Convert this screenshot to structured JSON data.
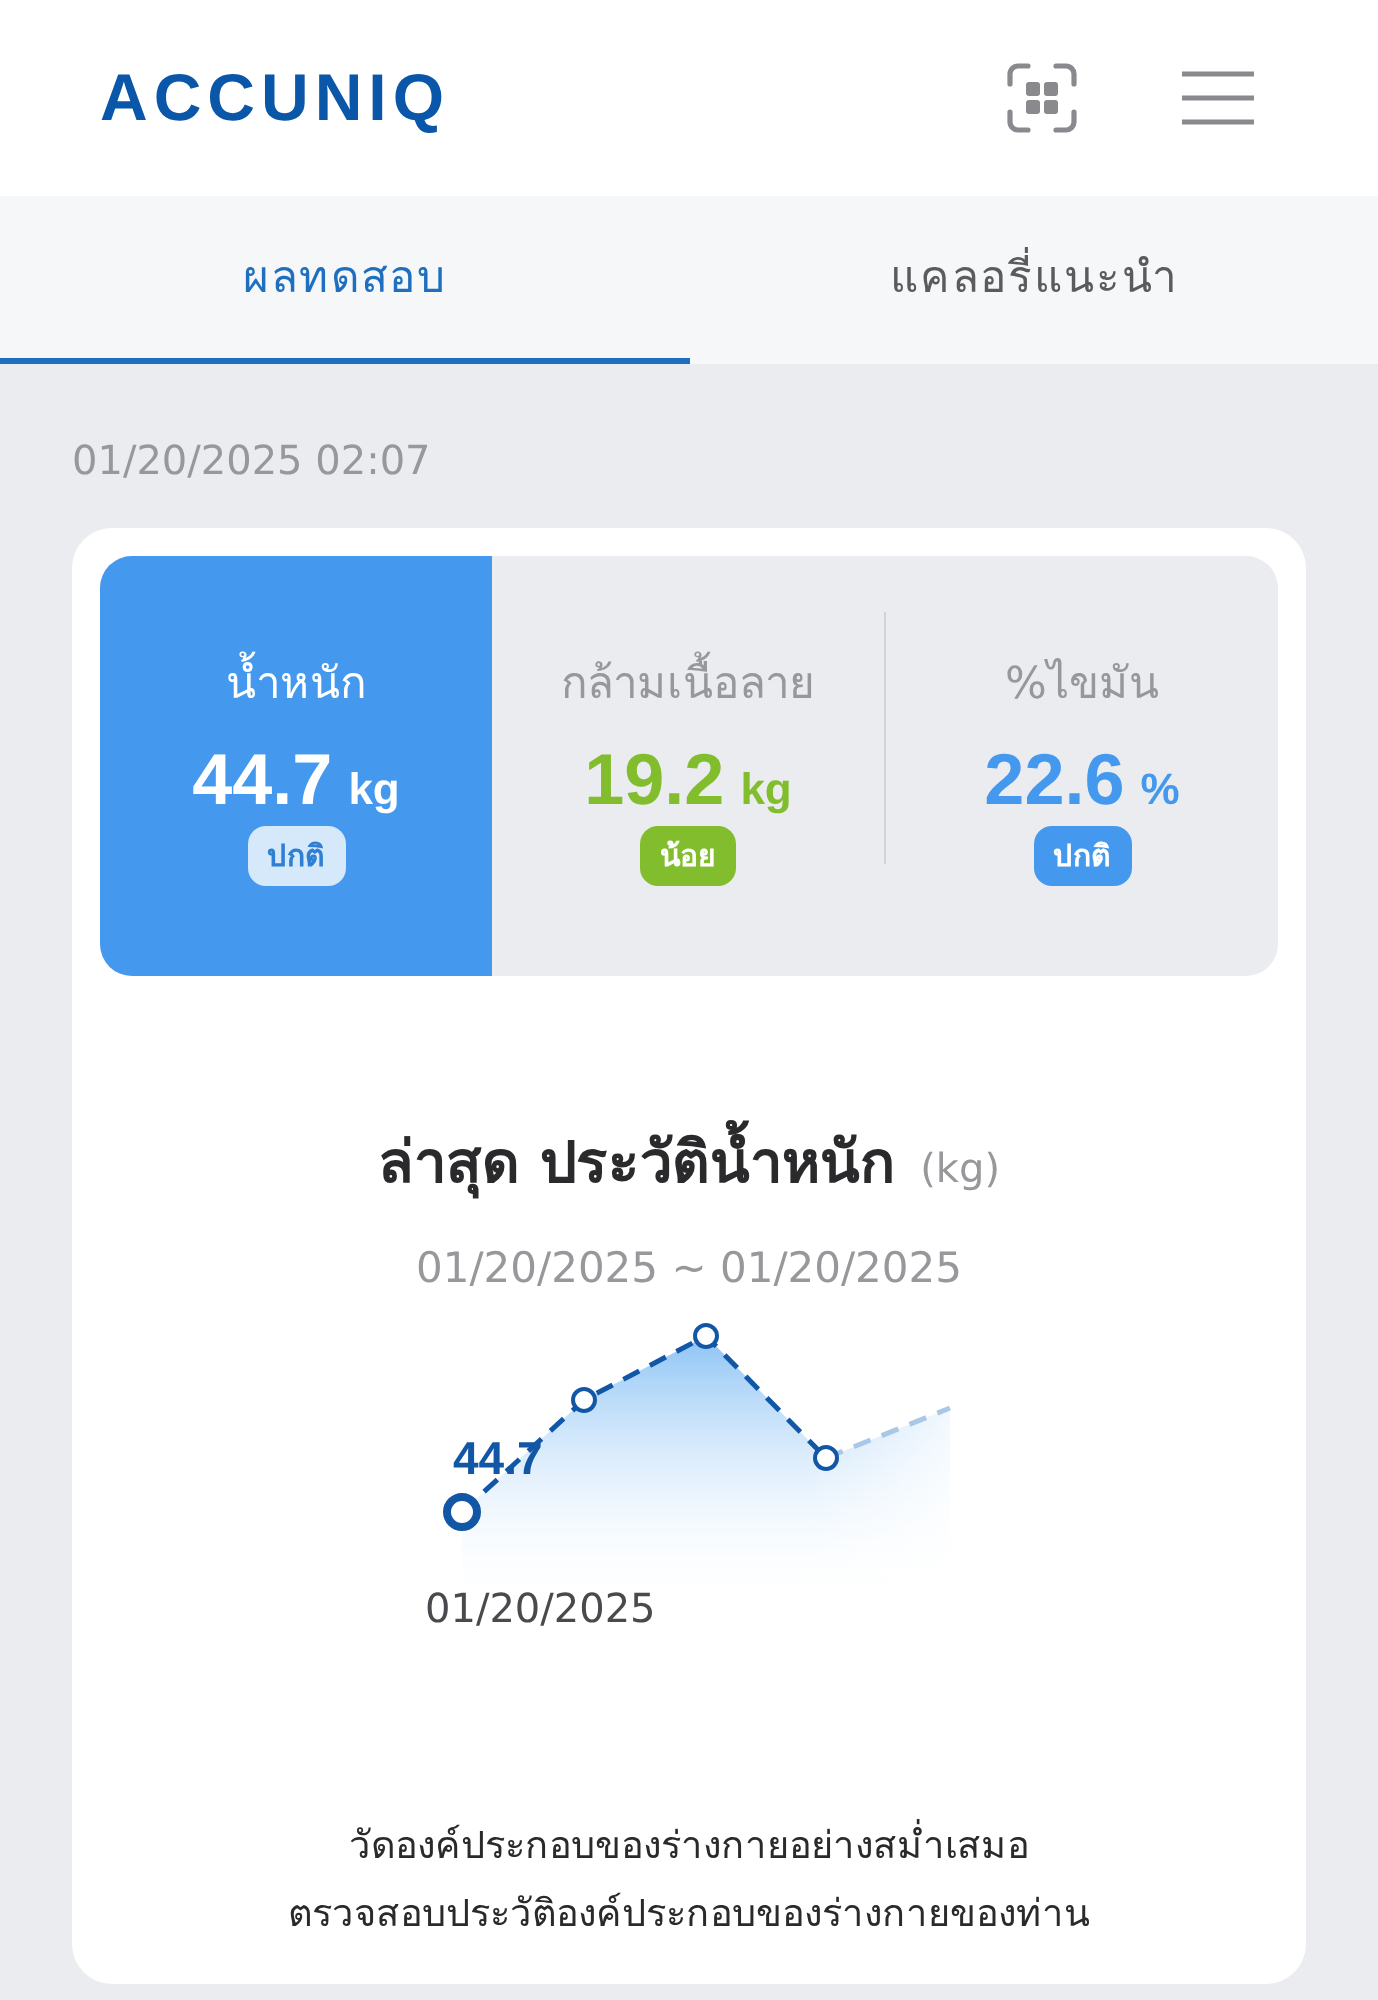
{
  "header": {
    "logo": "ACCUNIQ"
  },
  "tabs": [
    {
      "label": "ผลทดสอบ",
      "selected": true
    },
    {
      "label": "แคลอรี่แนะนำ",
      "selected": false
    }
  ],
  "timestamp": "01/20/2025 02:07",
  "metrics": [
    {
      "label": "น้ำหนัก",
      "value": "44.7",
      "unit": "kg",
      "status": "ปกติ",
      "color": "#4499ee",
      "selected": true
    },
    {
      "label": "กล้ามเนื้อลาย",
      "value": "19.2",
      "unit": "kg",
      "status": "น้อย",
      "color": "#82bd2e",
      "selected": false
    },
    {
      "label": "%ไขมัน",
      "value": "22.6",
      "unit": "%",
      "status": "ปกติ",
      "color": "#4499ee",
      "selected": false
    }
  ],
  "history": {
    "title": "ล่าสุด ประวัติน้ำหนัก",
    "unit": "(kg)",
    "range": "01/20/2025 ~ 01/20/2025",
    "point_label": "44.7",
    "date_label": "01/20/2025"
  },
  "footer_text": [
    "วัดองค์ประกอบของร่างกายอย่างสม่ำเสมอ",
    "ตรวจสอบประวัติองค์ประกอบของร่างกายของท่าน"
  ]
}
